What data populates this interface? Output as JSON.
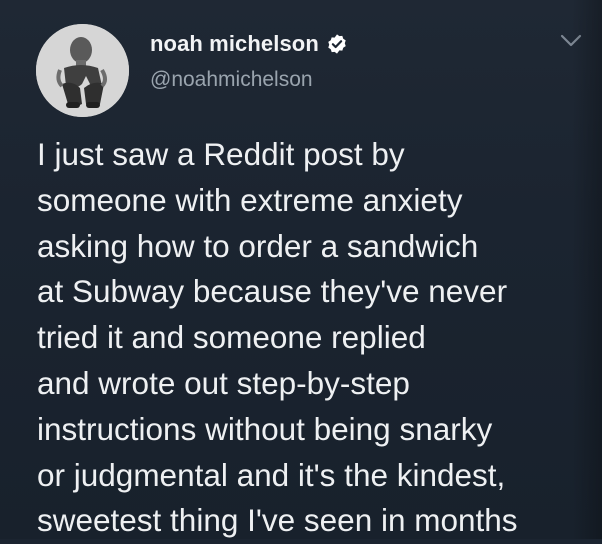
{
  "tweet": {
    "author": {
      "display_name": "noah michelson",
      "handle": "@noahmichelson",
      "verified": true,
      "avatar_icon": "profile-photo"
    },
    "text": "I just saw a Reddit post by\nsomeone with extreme anxiety\nasking how to order a sandwich\nat Subway because they've never\ntried it and someone replied\nand wrote out step-by-step\ninstructions without being snarky\nor judgmental and it's the kindest,\nsweetest thing I've seen in months",
    "menu_icon": "chevron-down-icon"
  },
  "colors": {
    "background": "#1b2430",
    "text_primary": "#eef0f2",
    "text_secondary": "#9aa4ae",
    "verified_badge": "#ffffff"
  }
}
